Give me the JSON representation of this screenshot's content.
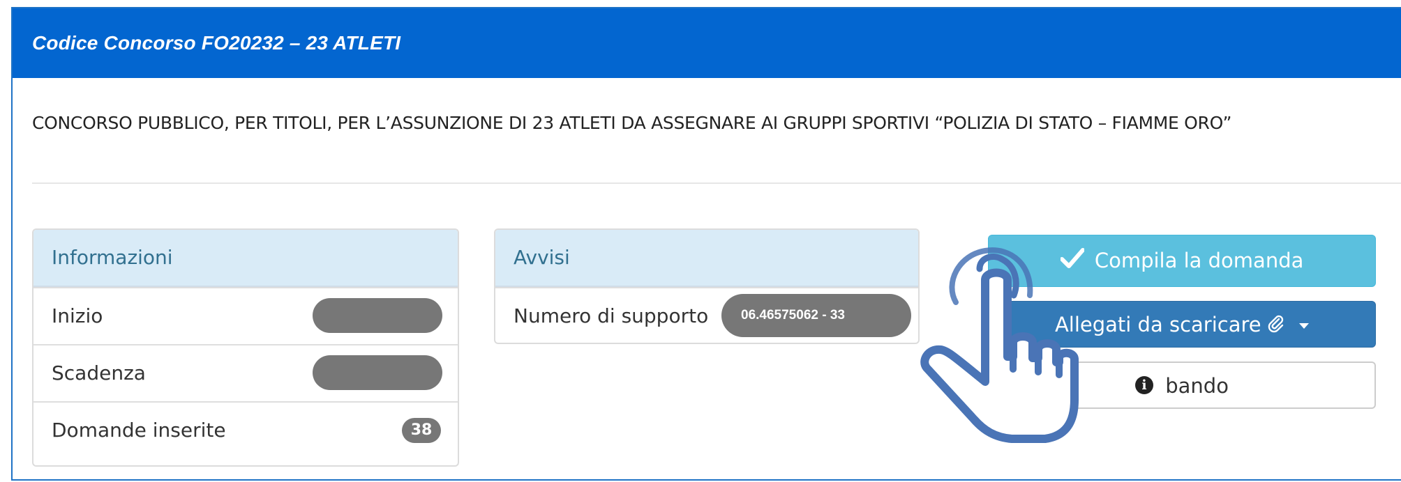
{
  "header": {
    "title": "Codice Concorso FO20232 – 23 ATLETI"
  },
  "description": "CONCORSO PUBBLICO, PER TITOLI, PER L’ASSUNZIONE DI 23 ATLETI DA ASSEGNARE AI GRUPPI SPORTIVI “POLIZIA DI STATO – FIAMME ORO”",
  "informazioni": {
    "heading": "Informazioni",
    "rows": [
      {
        "label": "Inizio",
        "value": ""
      },
      {
        "label": "Scadenza",
        "value": ""
      },
      {
        "label": "Domande inserite",
        "value": "38"
      }
    ]
  },
  "avvisi": {
    "heading": "Avvisi",
    "support_label": "Numero di supporto",
    "support_value": "06.46575062 - 33"
  },
  "buttons": {
    "compila": "Compila la domanda",
    "allegati": "Allegati da scaricare",
    "bando": "bando"
  },
  "colors": {
    "header_bg": "#0366d0",
    "success_bg": "#5bc0de",
    "primary_bg": "#337ab7",
    "badge_bg": "#777777",
    "list_head_bg": "#d9ebf7"
  },
  "icons": {
    "compila": "check-icon",
    "allegati": "paperclip-icon",
    "bando": "info-icon",
    "pointer": "hand-pointer-icon"
  }
}
